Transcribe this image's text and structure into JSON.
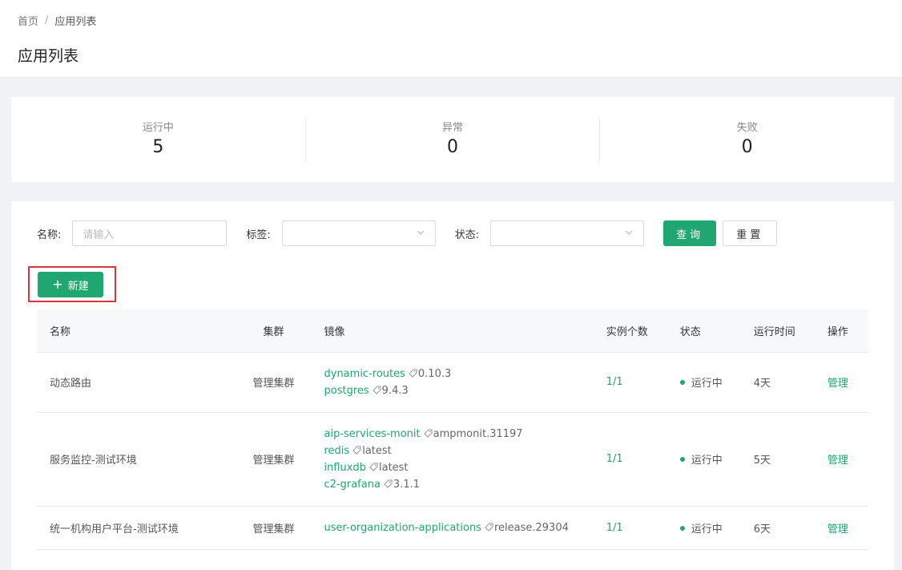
{
  "breadcrumb": {
    "home": "首页",
    "separator": "/",
    "current": "应用列表"
  },
  "page_title": "应用列表",
  "stats": [
    {
      "label": "运行中",
      "value": "5"
    },
    {
      "label": "异常",
      "value": "0"
    },
    {
      "label": "失败",
      "value": "0"
    }
  ],
  "filters": {
    "name_label": "名称:",
    "name_placeholder": "请输入",
    "tag_label": "标签:",
    "status_label": "状态:",
    "query_button": "查询",
    "reset_button": "重置"
  },
  "new_button": "新建",
  "colors": {
    "accent": "#20a670",
    "highlight_border": "#d9363e"
  },
  "table": {
    "headers": {
      "name": "名称",
      "cluster": "集群",
      "image": "镜像",
      "instances": "实例个数",
      "status": "状态",
      "uptime": "运行时间",
      "action": "操作"
    },
    "rows": [
      {
        "name": "动态路由",
        "cluster": "管理集群",
        "images": [
          {
            "name": "dynamic-routes",
            "tag": "0.10.3"
          },
          {
            "name": "postgres",
            "tag": "9.4.3"
          }
        ],
        "instances": "1/1",
        "status": "运行中",
        "uptime": "4天",
        "action": "管理"
      },
      {
        "name": "服务监控-测试环境",
        "cluster": "管理集群",
        "images": [
          {
            "name": "aip-services-monit",
            "tag": "ampmonit.31197"
          },
          {
            "name": "redis",
            "tag": "latest"
          },
          {
            "name": "influxdb",
            "tag": "latest"
          },
          {
            "name": "c2-grafana",
            "tag": "3.1.1"
          }
        ],
        "instances": "1/1",
        "status": "运行中",
        "uptime": "5天",
        "action": "管理"
      },
      {
        "name": "统一机构用户平台-测试环境",
        "cluster": "管理集群",
        "images": [
          {
            "name": "user-organization-applications",
            "tag": "release.29304"
          }
        ],
        "instances": "1/1",
        "status": "运行中",
        "uptime": "6天",
        "action": "管理"
      }
    ]
  }
}
